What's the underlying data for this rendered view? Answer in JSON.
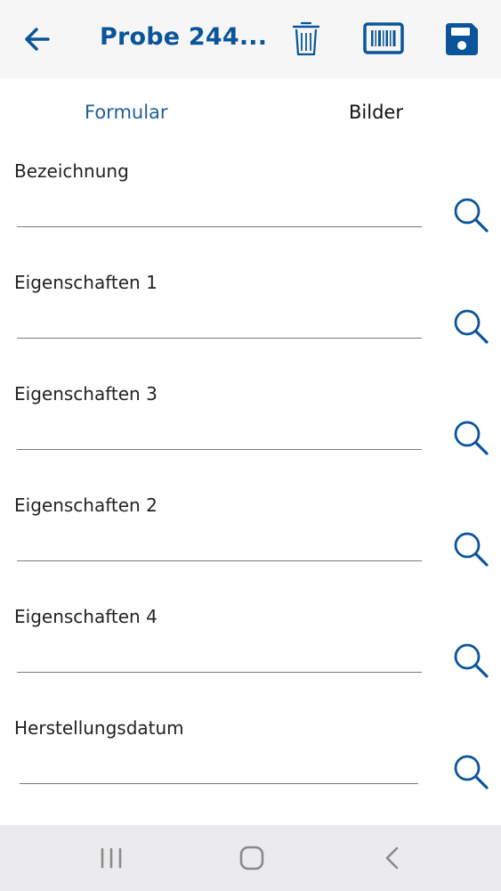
{
  "header": {
    "title": "Probe 244...",
    "back_icon": "arrow-left-icon",
    "delete_icon": "trash-icon",
    "barcode_icon": "barcode-icon",
    "save_icon": "floppy-disk-icon",
    "accent_color": "#0a559a"
  },
  "tabs": [
    {
      "label": "Formular",
      "active": true
    },
    {
      "label": "Bilder",
      "active": false
    }
  ],
  "form": {
    "fields": [
      {
        "label": "Bezeichnung",
        "value": ""
      },
      {
        "label": "Eigenschaften 1",
        "value": ""
      },
      {
        "label": "Eigenschaften 3",
        "value": ""
      },
      {
        "label": "Eigenschaften 2",
        "value": ""
      },
      {
        "label": "Eigenschaften 4",
        "value": ""
      },
      {
        "label": "Herstellungsdatum",
        "value": ""
      }
    ],
    "search_icon": "search-icon"
  },
  "system_nav": {
    "recent_icon": "recent-apps-icon",
    "home_icon": "home-icon",
    "back_icon": "back-chevron-icon"
  }
}
